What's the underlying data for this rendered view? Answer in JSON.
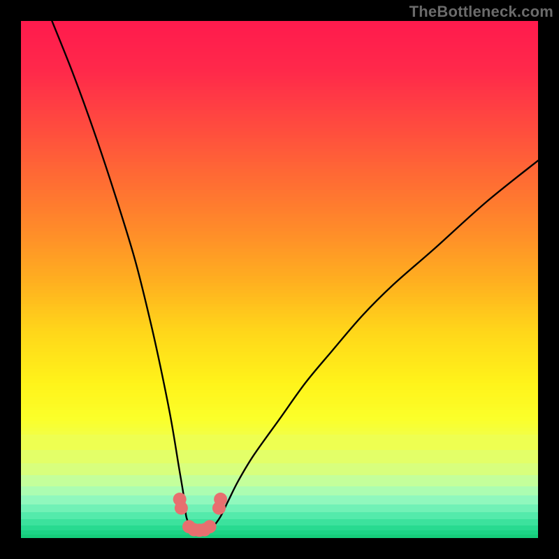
{
  "attribution": "TheBottleneck.com",
  "chart_data": {
    "type": "line",
    "title": "",
    "xlabel": "",
    "ylabel": "",
    "xlim": [
      0,
      100
    ],
    "ylim": [
      0,
      100
    ],
    "series": [
      {
        "name": "bottleneck-curve",
        "x": [
          6,
          10,
          14,
          18,
          22,
          25,
          27,
          29,
          30.5,
          31.5,
          32,
          33,
          34,
          35,
          36,
          37,
          38.5,
          40,
          42,
          45,
          50,
          55,
          60,
          66,
          72,
          80,
          90,
          100
        ],
        "y": [
          100,
          90,
          79,
          67,
          54,
          42,
          33,
          23,
          14,
          8,
          4,
          2,
          1.2,
          1,
          1.2,
          2,
          4,
          7,
          11,
          16,
          23,
          30,
          36,
          43,
          49,
          56,
          65,
          73
        ]
      },
      {
        "name": "trough-markers",
        "x": [
          30.7,
          31.0,
          32.5,
          33.5,
          34.5,
          35.5,
          36.5,
          38.3,
          38.6
        ],
        "y": [
          7.5,
          5.8,
          2.2,
          1.6,
          1.5,
          1.6,
          2.2,
          5.8,
          7.5
        ]
      }
    ],
    "gradient_stops": [
      {
        "pos": 0.0,
        "color": "#ff1a4d"
      },
      {
        "pos": 0.1,
        "color": "#ff2a4a"
      },
      {
        "pos": 0.2,
        "color": "#ff4a3f"
      },
      {
        "pos": 0.3,
        "color": "#ff6a34"
      },
      {
        "pos": 0.4,
        "color": "#ff8a2a"
      },
      {
        "pos": 0.5,
        "color": "#ffae20"
      },
      {
        "pos": 0.6,
        "color": "#ffd61a"
      },
      {
        "pos": 0.7,
        "color": "#fff31a"
      },
      {
        "pos": 0.77,
        "color": "#fbff2a"
      },
      {
        "pos": 0.82,
        "color": "#edff55"
      },
      {
        "pos": 0.87,
        "color": "#d6ff80"
      },
      {
        "pos": 0.9,
        "color": "#baffaa"
      },
      {
        "pos": 0.93,
        "color": "#8bf7c0"
      },
      {
        "pos": 0.96,
        "color": "#4de8a8"
      },
      {
        "pos": 0.985,
        "color": "#1fd68a"
      },
      {
        "pos": 1.0,
        "color": "#12c976"
      }
    ],
    "marker_color": "#e76f6f",
    "curve_color": "#000000"
  }
}
